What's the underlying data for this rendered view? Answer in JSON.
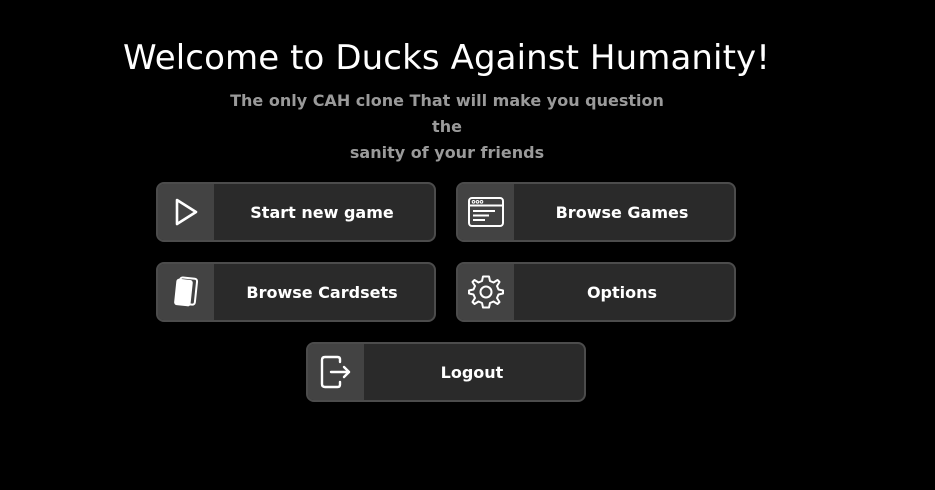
{
  "header": {
    "title": "Welcome to Ducks Against Humanity!",
    "subtitle_line1": "The only CAH clone That will make you question the",
    "subtitle_line2": "sanity of your friends"
  },
  "menu": {
    "start_new_game": {
      "label": "Start new game",
      "icon": "play-icon"
    },
    "browse_games": {
      "label": "Browse Games",
      "icon": "browser-window-icon"
    },
    "browse_cardsets": {
      "label": "Browse Cardsets",
      "icon": "cards-icon"
    },
    "options": {
      "label": "Options",
      "icon": "gear-icon"
    },
    "logout": {
      "label": "Logout",
      "icon": "logout-icon"
    }
  },
  "colors": {
    "background": "#000000",
    "button_body": "#2a2a2a",
    "button_icon_cell": "#434343",
    "button_border": "#4c4c4c",
    "subtitle": "#9a9a9a"
  }
}
